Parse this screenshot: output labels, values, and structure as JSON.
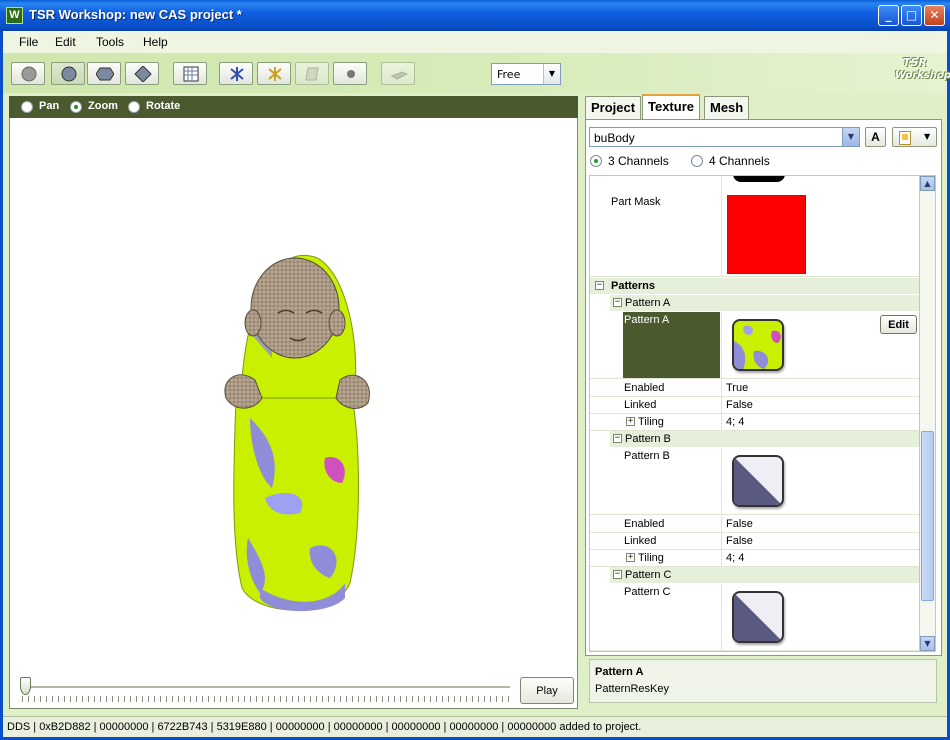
{
  "window": {
    "title": "TSR Workshop: new CAS project *",
    "app_icon_letter": "W",
    "minimize_glyph": "_",
    "maximize_glyph": "□",
    "close_glyph": "✕"
  },
  "menu": [
    "File",
    "Edit",
    "Tools",
    "Help"
  ],
  "toolbar": {
    "buttons": [
      {
        "icon": "sphere-flat-icon"
      },
      {
        "icon": "sphere-shaded-icon",
        "active": true
      },
      {
        "icon": "hexagon-icon"
      },
      {
        "icon": "diamond-icon"
      },
      {
        "icon": "grid-icon"
      },
      {
        "icon": "bones-blue-icon"
      },
      {
        "icon": "bones-yellow-icon"
      },
      {
        "icon": "floor-icon",
        "disabled": true
      },
      {
        "icon": "dot-icon"
      },
      {
        "icon": "shadow-plane-icon",
        "disabled": true
      }
    ],
    "camera_mode": "Free",
    "logo_line1": "TSR",
    "logo_line2": "Workshop"
  },
  "viewport": {
    "nav_modes": [
      {
        "label": "Pan",
        "selected": false
      },
      {
        "label": "Zoom",
        "selected": true
      },
      {
        "label": "Rotate",
        "selected": false
      }
    ],
    "play_label": "Play",
    "timeline_position": 0
  },
  "tabs": [
    {
      "label": "Project",
      "selected": false
    },
    {
      "label": "Texture",
      "selected": true
    },
    {
      "label": "Mesh",
      "selected": false
    }
  ],
  "texture": {
    "part": "buBody",
    "font_button": "A",
    "channels": [
      {
        "label": "3 Channels",
        "selected": true
      },
      {
        "label": "4 Channels",
        "selected": false
      }
    ],
    "part_mask_label": "Part Mask",
    "part_mask_color": "#ff0000",
    "patterns_label": "Patterns",
    "edit_label": "Edit",
    "patterns": [
      {
        "header": "Pattern A",
        "name": "Pattern A",
        "selected": true,
        "enabled_label": "Enabled",
        "enabled": "True",
        "linked_label": "Linked",
        "linked": "False",
        "tiling_label": "Tiling",
        "tiling": "4; 4"
      },
      {
        "header": "Pattern B",
        "name": "Pattern B",
        "selected": false,
        "enabled_label": "Enabled",
        "enabled": "False",
        "linked_label": "Linked",
        "linked": "False",
        "tiling_label": "Tiling",
        "tiling": "4; 4"
      },
      {
        "header": "Pattern C",
        "name": "Pattern C",
        "selected": false
      }
    ],
    "expand_glyph": "+",
    "collapse_glyph": "−"
  },
  "description": {
    "title": "Pattern A",
    "text": "PatternResKey"
  },
  "status": "DDS | 0xB2D882 | 00000000 | 6722B743 | 5319E880 | 00000000 | 00000000 | 00000000 | 00000000 | 00000000 added to project.",
  "colors": {
    "selection": "#4a5a2e",
    "header_bar": "#4a5a2e",
    "accent_tab": "#e8a23a",
    "lime": "#c8f000",
    "lavender": "#8f8cd8",
    "skin": "#9a8670"
  }
}
